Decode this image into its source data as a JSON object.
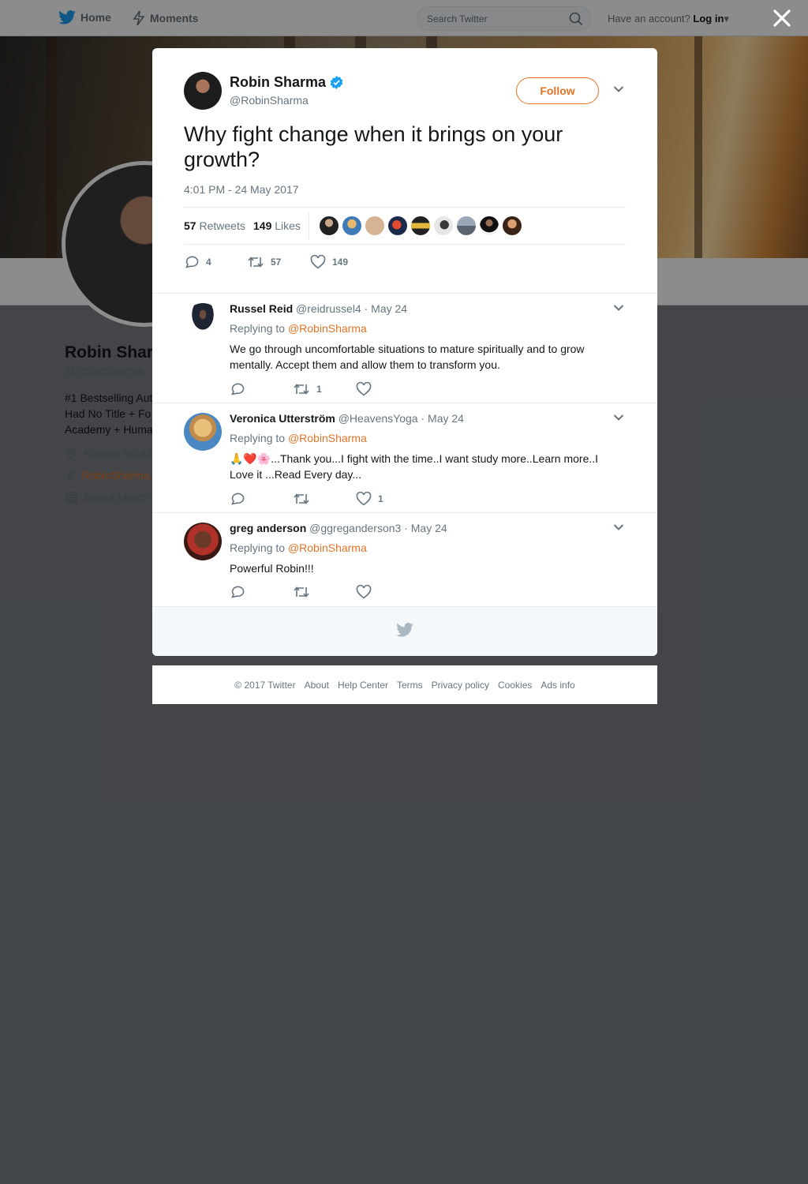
{
  "topbar": {
    "home_label": "Home",
    "moments_label": "Moments",
    "search_placeholder": "Search Twitter",
    "account_prompt": "Have an account?",
    "login_label": "Log in"
  },
  "profile": {
    "name": "Robin Shar",
    "handle": "@RobinSharma",
    "bio": "#1 Bestselling Aut\nHad No Title + Fo\nAcademy + Huma",
    "location": "Airports World",
    "website": "RobinSharma.",
    "joined": "Joined March"
  },
  "tweet": {
    "author_name": "Robin Sharma",
    "author_handle": "@RobinSharma",
    "verified": true,
    "follow_label": "Follow",
    "text": "Why fight change when it brings on your growth?",
    "timestamp": "4:01 PM - 24 May 2017",
    "retweets_count": "57",
    "retweets_label": "Retweets",
    "likes_count": "149",
    "likes_label": "Likes",
    "liker_count": 9,
    "actions": {
      "replies": "4",
      "retweets": "57",
      "likes": "149"
    }
  },
  "replies": [
    {
      "name": "Russel Reid",
      "handle": "@reidrussel4",
      "date": "· May 24",
      "replying_prefix": "Replying to",
      "replying_to": "@RobinSharma",
      "text": "We go through uncomfortable  situations to mature spiritually and to grow mentally.  Accept them and allow them to transform you.",
      "reply_count": "",
      "retweet_count": "1",
      "like_count": ""
    },
    {
      "name": "Veronica Utterström",
      "handle": "@HeavensYoga",
      "date": "· May 24",
      "replying_prefix": "Replying to",
      "replying_to": "@RobinSharma",
      "text": "🙏❤️🌸...Thank you...I fight with the time..I want study more..Learn more..I Love it ...Read Every day...",
      "reply_count": "",
      "retweet_count": "",
      "like_count": "1"
    },
    {
      "name": "greg anderson",
      "handle": "@ggreganderson3",
      "date": "· May 24",
      "replying_prefix": "Replying to",
      "replying_to": "@RobinSharma",
      "text": "Powerful Robin!!!",
      "reply_count": "",
      "retweet_count": "",
      "like_count": ""
    }
  ],
  "footer": {
    "copyright": "© 2017 Twitter",
    "links": [
      "About",
      "Help Center",
      "Terms",
      "Privacy policy",
      "Cookies",
      "Ads info"
    ]
  },
  "colors": {
    "accent": "#e0742a",
    "verified": "#1da1f2",
    "twitter_blue": "#1da1f2",
    "text_secondary": "#66757f"
  },
  "icons": [
    "twitter-bird-icon",
    "lightning-icon",
    "search-icon",
    "close-icon",
    "verified-badge-icon",
    "chevron-down-icon",
    "reply-icon",
    "retweet-icon",
    "like-icon"
  ]
}
